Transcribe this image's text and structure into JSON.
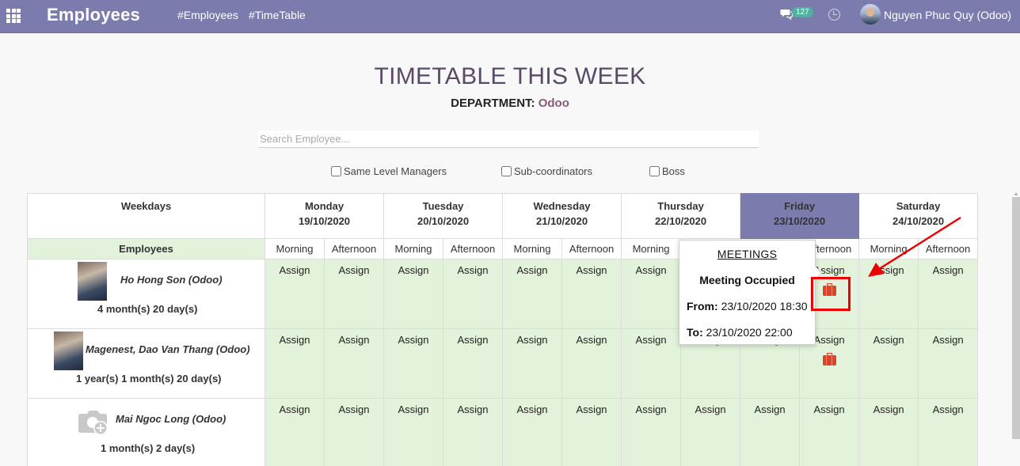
{
  "app": {
    "title": "Employees",
    "menu": [
      "#Employees",
      "#TimeTable"
    ]
  },
  "nav": {
    "message_count": "127",
    "user_name": "Nguyen Phuc Quy (Odoo)"
  },
  "page": {
    "title": "TIMETABLE THIS WEEK",
    "department_label": "DEPARTMENT:",
    "department_value": "Odoo",
    "search_placeholder": "Search Employee..."
  },
  "filters": [
    "Same Level Managers",
    "Sub-coordinators",
    "Boss"
  ],
  "table": {
    "weekdays_label": "Weekdays",
    "employees_label": "Employees",
    "days": [
      {
        "name": "Monday",
        "date": "19/10/2020"
      },
      {
        "name": "Tuesday",
        "date": "20/10/2020"
      },
      {
        "name": "Wednesday",
        "date": "21/10/2020"
      },
      {
        "name": "Thursday",
        "date": "22/10/2020"
      },
      {
        "name": "Friday",
        "date": "23/10/2020"
      },
      {
        "name": "Saturday",
        "date": "24/10/2020"
      }
    ],
    "today_index": 4,
    "period_labels": [
      "Morning",
      "Afternoon"
    ],
    "assign_label": "Assign",
    "employees": [
      {
        "name": "Ho Hong Son (Odoo)",
        "tenure": "4 month(s) 20 day(s)",
        "photo": "photo",
        "busy_slots": [
          9
        ]
      },
      {
        "name": "Magenest, Dao Van Thang (Odoo)",
        "tenure": "1 year(s) 1 month(s) 20 day(s)",
        "photo": "photo",
        "busy_slots": [
          9
        ]
      },
      {
        "name": "Mai Ngoc Long (Odoo)",
        "tenure": "1 month(s) 2 day(s)",
        "photo": "placeholder",
        "busy_slots": []
      }
    ]
  },
  "popover": {
    "heading": "MEETINGS",
    "status": "Meeting Occupied",
    "from_label": "From:",
    "from_value": "23/10/2020 18:30",
    "to_label": "To:",
    "to_value": "23/10/2020 22:00"
  },
  "colors": {
    "topbar": "#7c7bad",
    "slot_bg": "#e3f2da",
    "brand_text": "#875a7b",
    "meeting_icon": "#d9442b",
    "highlight": "#e00000"
  },
  "icons": {
    "apps": "apps-grid-icon",
    "chat": "chat-icon",
    "clock": "clock-icon",
    "meeting": "briefcase-icon",
    "no_photo": "camera-add-icon"
  }
}
